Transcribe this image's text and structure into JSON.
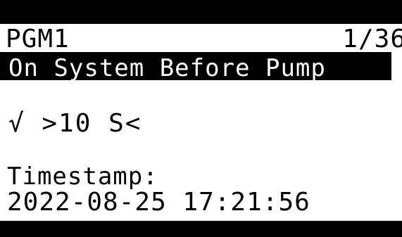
{
  "header": {
    "program": "PGM1",
    "page_indicator": "1/36"
  },
  "program_name": "On_System_Before_Pump",
  "status": {
    "check_icon": "check-icon",
    "value": ">10 S<"
  },
  "timestamp": {
    "label": "Timestamp:",
    "value": "2022-08-25 17:21:56"
  },
  "colors": {
    "background": "#ffffff",
    "foreground": "#000000",
    "highlight": "#000000"
  }
}
